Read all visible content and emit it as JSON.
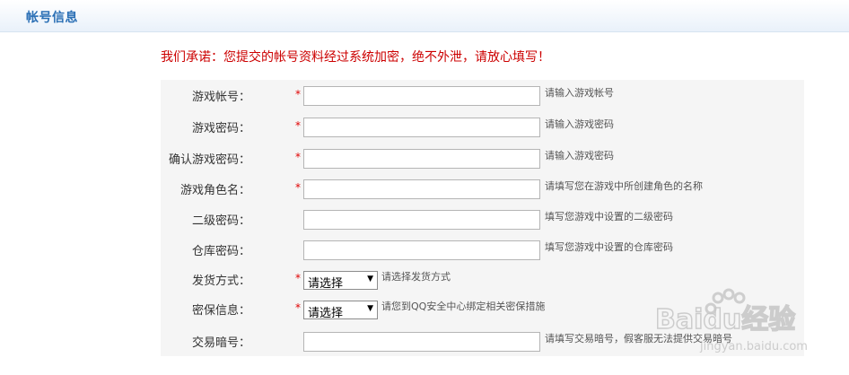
{
  "header": {
    "title": "帐号信息"
  },
  "notice": "我们承诺：您提交的帐号资料经过系统加密，绝不外泄，请放心填写！",
  "required_mark": "*",
  "form": {
    "game_account": {
      "label": "游戏帐号：",
      "value": "",
      "hint": "请输入游戏帐号"
    },
    "game_password": {
      "label": "游戏密码：",
      "value": "",
      "hint": "请输入游戏密码"
    },
    "confirm_password": {
      "label": "确认游戏密码：",
      "value": "",
      "hint": "请输入游戏密码"
    },
    "role_name": {
      "label": "游戏角色名：",
      "value": "",
      "hint": "请填写您在游戏中所创建角色的名称"
    },
    "second_password": {
      "label": "二级密码：",
      "value": "",
      "hint": "填写您游戏中设置的二级密码"
    },
    "warehouse_password": {
      "label": "仓库密码：",
      "value": "",
      "hint": "填写您游戏中设置的仓库密码"
    },
    "delivery_method": {
      "label": "发货方式：",
      "selected": "请选择",
      "hint": "请选择发货方式"
    },
    "security_info": {
      "label": "密保信息：",
      "selected": "请选择",
      "hint": "请您到QQ安全中心绑定相关密保措施"
    },
    "trade_code": {
      "label": "交易暗号：",
      "value": "",
      "hint": "请填写交易暗号，假客服无法提供交易暗号"
    }
  },
  "watermark": {
    "text": "Baidu经验",
    "url": "jingyan.baidu.com"
  }
}
